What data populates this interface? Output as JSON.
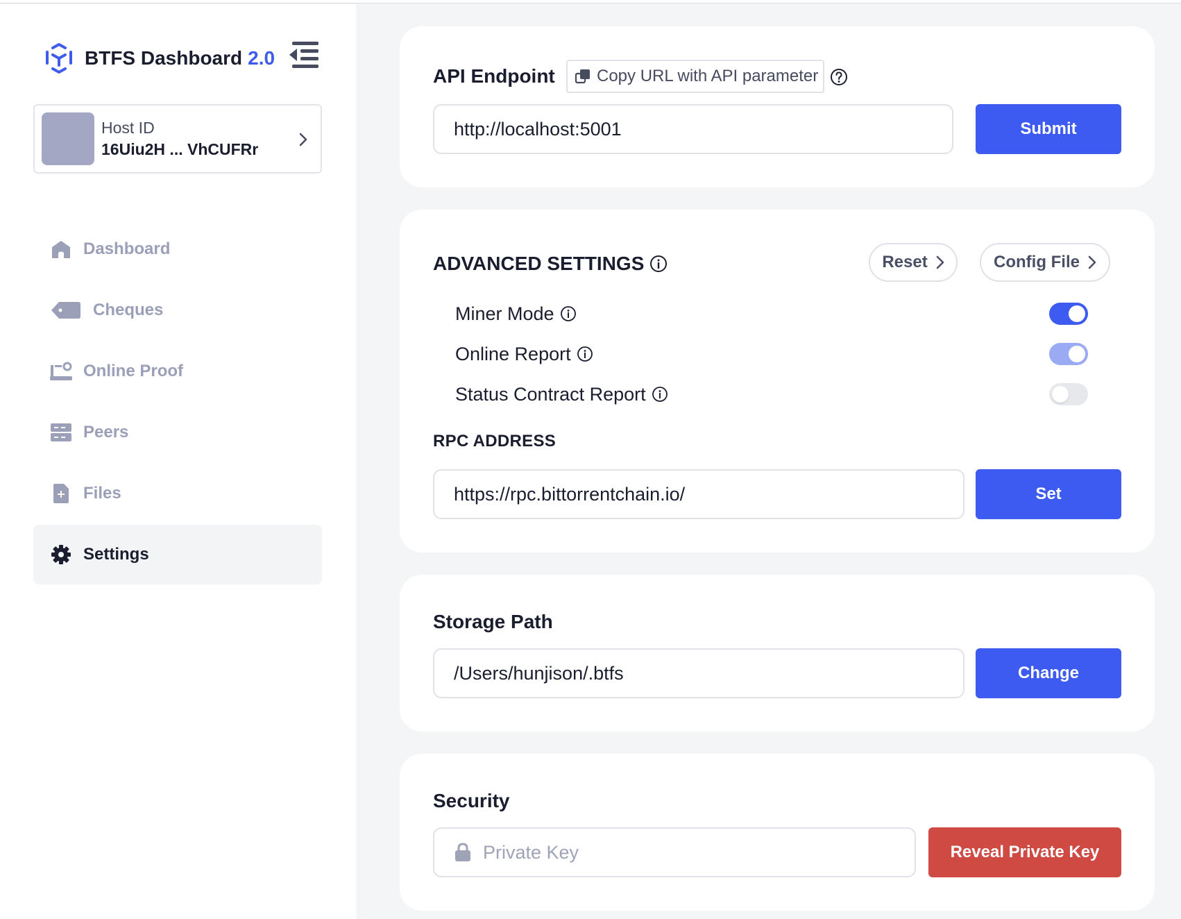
{
  "brand": {
    "title": "BTFS Dashboard",
    "version": "2.0"
  },
  "host": {
    "label": "Host ID",
    "value": "16Uiu2H ... VhCUFRr"
  },
  "sidebar": {
    "items": [
      {
        "label": "Dashboard",
        "icon": "home-icon"
      },
      {
        "label": "Cheques",
        "icon": "tag-icon"
      },
      {
        "label": "Online Proof",
        "icon": "proof-icon"
      },
      {
        "label": "Peers",
        "icon": "server-icon"
      },
      {
        "label": "Files",
        "icon": "file-add-icon"
      },
      {
        "label": "Settings",
        "icon": "gear-icon",
        "active": true
      }
    ]
  },
  "api": {
    "title": "API Endpoint",
    "copy_label": "Copy URL with API parameter",
    "value": "http://localhost:5001",
    "submit_label": "Submit"
  },
  "advanced": {
    "title": "ADVANCED SETTINGS",
    "reset_label": "Reset",
    "config_label": "Config File",
    "settings": [
      {
        "label": "Miner Mode",
        "state": "on"
      },
      {
        "label": "Online Report",
        "state": "on-disabled"
      },
      {
        "label": "Status Contract Report",
        "state": "off"
      }
    ],
    "rpc_title": "RPC ADDRESS",
    "rpc_value": "https://rpc.bittorrentchain.io/",
    "set_label": "Set"
  },
  "storage": {
    "title": "Storage Path",
    "value": "/Users/hunjison/.btfs",
    "change_label": "Change"
  },
  "security": {
    "title": "Security",
    "placeholder": "Private Key",
    "reveal_label": "Reveal Private Key"
  },
  "colors": {
    "primary": "#3d5af1",
    "danger": "#cf4a43",
    "muted": "#9b9fb8"
  }
}
